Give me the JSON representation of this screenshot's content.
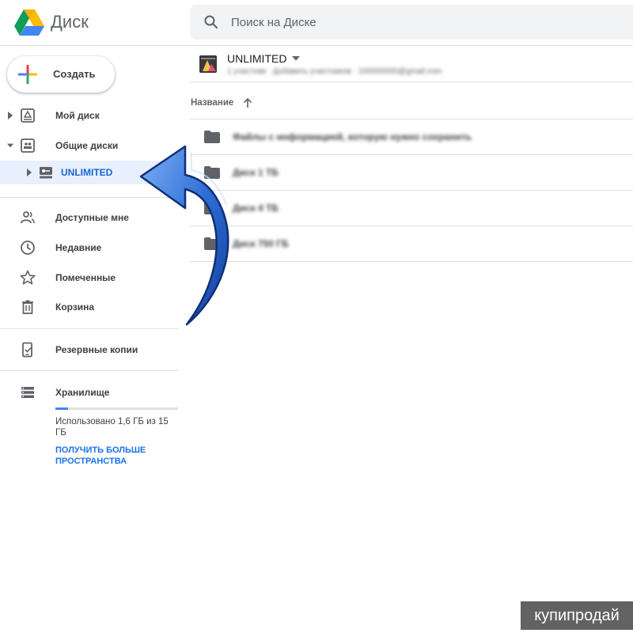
{
  "header": {
    "app_title": "Диск",
    "search_placeholder": "Поиск на Диске"
  },
  "sidebar": {
    "create_label": "Создать",
    "items": [
      {
        "label": "Мой диск",
        "icon": "my-drive-icon"
      },
      {
        "label": "Общие диски",
        "icon": "shared-drives-icon"
      },
      {
        "label": "UNLIMITED",
        "icon": "shared-drive-icon"
      },
      {
        "label": "Доступные мне",
        "icon": "people-icon"
      },
      {
        "label": "Недавние",
        "icon": "clock-icon"
      },
      {
        "label": "Помеченные",
        "icon": "star-icon"
      },
      {
        "label": "Корзина",
        "icon": "trash-icon"
      },
      {
        "label": "Резервные копии",
        "icon": "backup-icon"
      },
      {
        "label": "Хранилище",
        "icon": "storage-icon"
      }
    ],
    "storage": {
      "used_text": "Использовано 1,6 ГБ из 15 ГБ",
      "used_fraction": 0.1,
      "upgrade_label": "ПОЛУЧИТЬ БОЛЬШЕ ПРОСТРАНСТВА"
    }
  },
  "main": {
    "drive_name": "UNLIMITED",
    "drive_members": "1 участник · Добавить участников · 100000000@gmail.com",
    "column_name": "Название",
    "files": [
      {
        "name": "Файлы с информацией, которую нужно сохранить"
      },
      {
        "name": "Диск 1 ТБ"
      },
      {
        "name": "Диск 4 ТБ"
      },
      {
        "name": "Диск 750 ГБ"
      }
    ]
  },
  "watermark": "купипродай",
  "colors": {
    "accent": "#1a73e8",
    "selected_bg": "#e8f0fe",
    "arrow_blue": "#2f6fd6"
  }
}
